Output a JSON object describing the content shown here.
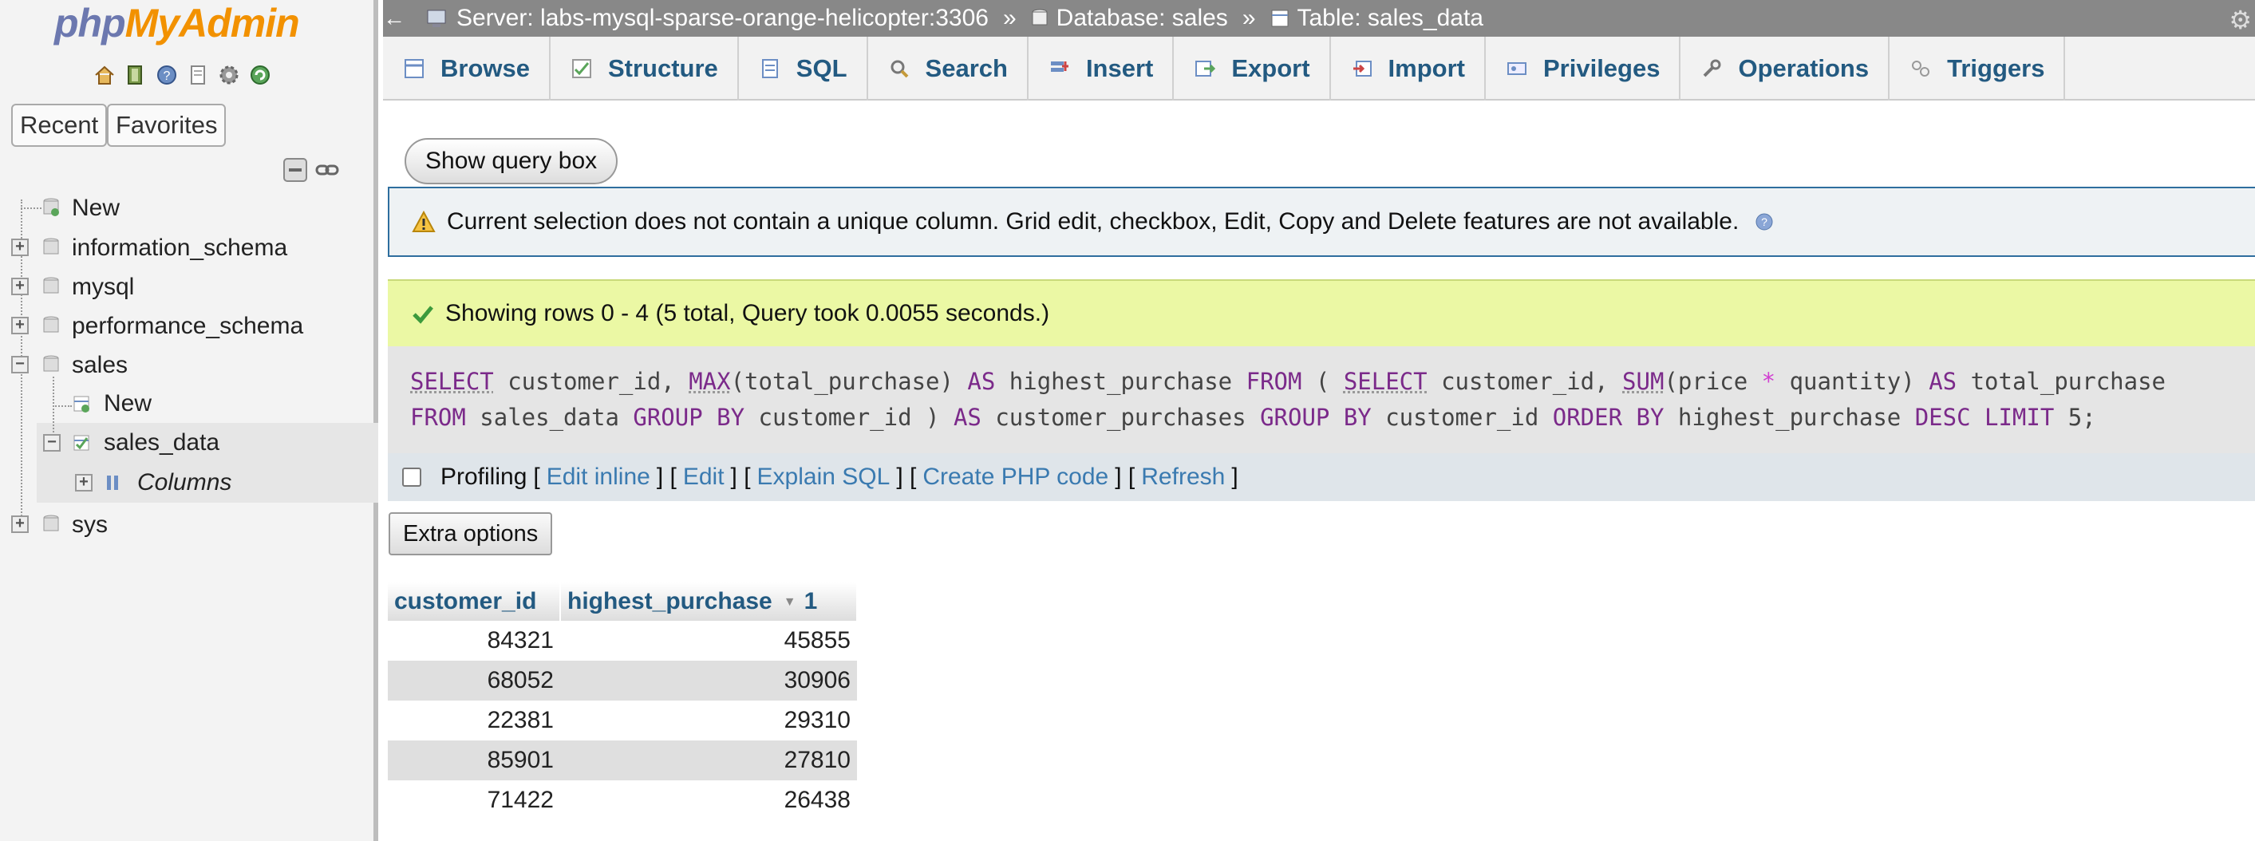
{
  "nav": {
    "logo_php": "php",
    "logo_myadmin": "MyAdmin",
    "quick_icons": [
      "home-icon",
      "exit-icon",
      "help-icon",
      "docs-icon",
      "settings-icon",
      "reload-icon"
    ],
    "tabs": [
      "Recent",
      "Favorites"
    ],
    "tree": {
      "new_label": "New",
      "databases": [
        {
          "name": "information_schema"
        },
        {
          "name": "mysql"
        },
        {
          "name": "performance_schema"
        },
        {
          "name": "sales",
          "children": {
            "new_label": "New",
            "table": "sales_data",
            "columns_label": "Columns"
          }
        },
        {
          "name": "sys"
        }
      ]
    }
  },
  "breadcrumb": {
    "server": "Server: labs-mysql-sparse-orange-helicopter:3306",
    "database": "Database: sales",
    "table": "Table: sales_data",
    "separator": "»"
  },
  "menu": {
    "tabs": [
      "Browse",
      "Structure",
      "SQL",
      "Search",
      "Insert",
      "Export",
      "Import",
      "Privileges",
      "Operations",
      "Triggers"
    ]
  },
  "main": {
    "show_query_label": "Show query box",
    "notice_text": "Current selection does not contain a unique column. Grid edit, checkbox, Edit, Copy and Delete features are not available.",
    "success_text": "Showing rows 0 - 4 (5 total, Query took 0.0055 seconds.)",
    "sql_query": "SELECT customer_id, MAX(total_purchase) AS highest_purchase FROM ( SELECT customer_id, SUM(price * quantity) AS total_purchase FROM sales_data GROUP BY customer_id ) AS customer_purchases GROUP BY customer_id ORDER BY highest_purchase DESC LIMIT 5;",
    "profiling": {
      "label": "Profiling",
      "links": [
        "Edit inline",
        "Edit",
        "Explain SQL",
        "Create PHP code",
        "Refresh"
      ]
    },
    "extra_options_label": "Extra options",
    "results": {
      "columns": [
        "customer_id",
        "highest_purchase"
      ],
      "sort_index": "1",
      "rows": [
        [
          "84321",
          "45855"
        ],
        [
          "68052",
          "30906"
        ],
        [
          "22381",
          "29310"
        ],
        [
          "85901",
          "27810"
        ],
        [
          "71422",
          "26438"
        ]
      ]
    }
  }
}
